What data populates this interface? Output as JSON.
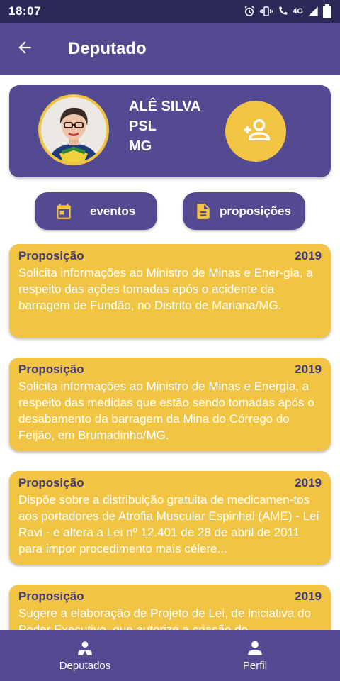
{
  "status_bar": {
    "time": "18:07",
    "network_label": "4G",
    "icons": [
      "alarm-icon",
      "vibrate-icon",
      "volte-icon",
      "signal-icon",
      "battery-icon"
    ]
  },
  "app_bar": {
    "title": "Deputado",
    "back_icon": "arrow-left-icon"
  },
  "profile": {
    "name": "ALÊ SILVA",
    "party": "PSL",
    "state": "MG",
    "follow_icon": "person-add-icon"
  },
  "actions": {
    "eventos_label": "eventos",
    "eventos_icon": "calendar-icon",
    "proposicoes_label": "proposições",
    "proposicoes_icon": "document-icon"
  },
  "propositions": [
    {
      "type": "Proposição",
      "year": "2019",
      "text": "Solicita informações ao Ministro de Minas e Ener-gia, a respeito das ações tomadas após o acidente da barragem de Fundão, no Distrito de Mariana/MG."
    },
    {
      "type": "Proposição",
      "year": "2019",
      "text": "Solicita informações ao Ministro de Minas e Energia, a respeito das medidas que estão sendo tomadas após o desabamento da barragem da Mina do Córrego do Feijão, em Brumadinho/MG."
    },
    {
      "type": "Proposição",
      "year": "2019",
      "text": "Dispõe sobre a distribuição gratuita de medicamen-tos aos portadores de Atrofia Muscular Espinhal (AME) - Lei Ravi - e altera a Lei nº 12.401 de 28 de abril de 2011 para impor procedimento mais célere..."
    },
    {
      "type": "Proposição",
      "year": "2019",
      "text": "Sugere a elaboração de Projeto de Lei, de iniciativa do Poder Executivo, que autorize a criação do"
    }
  ],
  "bottom_nav": {
    "deputados_label": "Deputados",
    "deputados_icon": "group-icon",
    "perfil_label": "Perfil",
    "perfil_icon": "person-icon"
  },
  "colors": {
    "primary": "#534a91",
    "accent": "#f2c444",
    "status_bar": "#2a2958",
    "card_title": "#3f3a78"
  }
}
